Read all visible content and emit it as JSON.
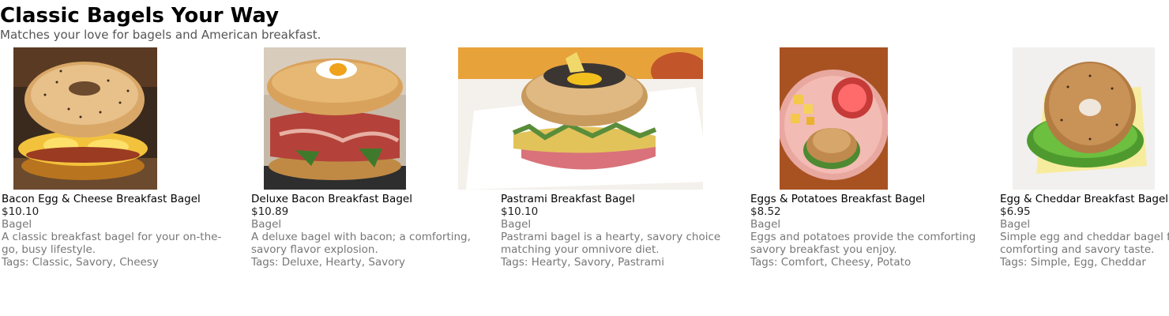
{
  "page": {
    "title": "Classic Bagels Your Way",
    "subtitle": "Matches your love for bagels and American breakfast."
  },
  "products": [
    {
      "name": "Bacon Egg & Cheese Breakfast Bagel",
      "price": "$10.10",
      "category": "Bagel",
      "description": "A classic breakfast bagel for your on-the-go, busy lifestyle.",
      "tags": "Tags: Classic, Savory, Cheesy",
      "image_icon": "bacon-egg-cheese-bagel-photo"
    },
    {
      "name": "Deluxe Bacon Breakfast Bagel",
      "price": "$10.89",
      "category": "Bagel",
      "description": "A deluxe bagel with bacon; a comforting, savory flavor explosion.",
      "tags": "Tags: Deluxe, Hearty, Savory",
      "image_icon": "deluxe-bacon-bagel-photo"
    },
    {
      "name": "Pastrami Breakfast Bagel",
      "price": "$10.10",
      "category": "Bagel",
      "description": "Pastrami bagel is a hearty, savory choice matching your omnivore diet.",
      "tags": "Tags: Hearty, Savory, Pastrami",
      "image_icon": "pastrami-bagel-photo"
    },
    {
      "name": "Eggs & Potatoes Breakfast Bagel",
      "price": "$8.52",
      "category": "Bagel",
      "description": "Eggs and potatoes provide the comforting savory breakfast you enjoy.",
      "tags": "Tags: Comfort, Cheesy, Potato",
      "image_icon": "eggs-potatoes-bagel-photo"
    },
    {
      "name": "Egg & Cheddar Breakfast Bagel",
      "price": "$6.95",
      "category": "Bagel",
      "description": "Simple egg and cheddar bagel for comforting and savory taste.",
      "tags": "Tags: Simple, Egg, Cheddar",
      "image_icon": "egg-cheddar-bagel-photo"
    }
  ]
}
